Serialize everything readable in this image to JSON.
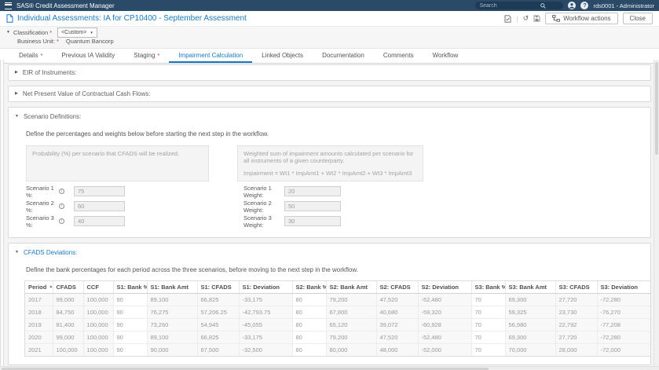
{
  "topbar": {
    "app_title": "SAS® Credit Assessment Manager",
    "search_placeholder": "Search",
    "username": "rds0001 - Administrator"
  },
  "titlebar": {
    "page_title": "Individual Assessments: IA for CP10400 - September Assessment",
    "workflow_actions_label": "Workflow actions",
    "close_label": "Close"
  },
  "meta": {
    "classification_label": "Classification",
    "classification_required": "*",
    "classification_value": "<Custom>",
    "business_unit_label": "Business Unit:",
    "business_unit_required": "*",
    "business_unit_value": "Quantum Bancorp"
  },
  "tabs": [
    {
      "label": "Details",
      "required_marker": "*"
    },
    {
      "label": "Previous IA Validity"
    },
    {
      "label": "Staging",
      "required_marker": "*"
    },
    {
      "label": "Impairment Calculation",
      "active": true
    },
    {
      "label": "Linked Objects"
    },
    {
      "label": "Documentation"
    },
    {
      "label": "Comments"
    },
    {
      "label": "Workflow"
    }
  ],
  "sections": {
    "eir": {
      "title": "EIR of Instruments:"
    },
    "npv": {
      "title": "Net Present Value of Contractual Cash Flows:"
    },
    "scenario": {
      "title": "Scenario Definitions:",
      "description": "Define the percentages and weights below before starting the next step in the workflow.",
      "probability_note": "Probability (%) per scenario that CFADS will be realized.",
      "weight_note": "Weighted sum of impairment amounts calculated per scenario for all instruments of a given counterparty.",
      "weight_formula": "Impairment = Wt1 * ImpAmt1 + Wt2 * ImpAmt2 + Wt3 * ImpAmt3",
      "rows": [
        {
          "pct_label": "Scenario 1 %:",
          "pct_value": "75",
          "weight_label": "Scenario 1 Weight:",
          "weight_value": "20"
        },
        {
          "pct_label": "Scenario 2 %:",
          "pct_value": "60",
          "weight_label": "Scenario 2 Weight:",
          "weight_value": "50"
        },
        {
          "pct_label": "Scenario 3 %:",
          "pct_value": "40",
          "weight_label": "Scenario 3 Weight:",
          "weight_value": "30"
        }
      ]
    },
    "cfads": {
      "title": "CFADS Deviations:",
      "description": "Define the bank percentages for each period across the three scenarios, before moving to the next step in the workflow.",
      "table": {
        "columns": [
          "Period",
          "CFADS",
          "CCF",
          "S1: Bank %",
          "S1: Bank Amt",
          "S1: CFADS",
          "S1: Deviation",
          "S2: Bank %",
          "S2: Bank Amt",
          "S2: CFADS",
          "S2: Deviation",
          "S3: Bank %",
          "S3: Bank Amt",
          "S3: CFADS",
          "S3: Deviation"
        ],
        "sorted_column_index": 0,
        "sort_glyph": "▲",
        "editable_column_indices": [
          3,
          7,
          11
        ],
        "rows": [
          [
            "2017",
            "99,000",
            "100,000",
            "90",
            "89,100",
            "66,825",
            "-33,175",
            "80",
            "79,200",
            "47,520",
            "-52,480",
            "70",
            "69,300",
            "27,720",
            "-72,280"
          ],
          [
            "2018",
            "84,750",
            "100,000",
            "90",
            "76,275",
            "57,206.25",
            "-42,793.75",
            "80",
            "67,800",
            "40,680",
            "-59,320",
            "70",
            "59,325",
            "23,730",
            "-76,270"
          ],
          [
            "2019",
            "81,400",
            "100,000",
            "90",
            "73,260",
            "54,945",
            "-45,055",
            "80",
            "65,120",
            "39,072",
            "-60,928",
            "70",
            "56,980",
            "22,792",
            "-77,208"
          ],
          [
            "2020",
            "99,000",
            "100,000",
            "90",
            "89,100",
            "66,825",
            "-33,175",
            "80",
            "79,200",
            "47,520",
            "-52,480",
            "70",
            "69,300",
            "27,720",
            "-72,280"
          ],
          [
            "2021",
            "100,000",
            "100,000",
            "90",
            "90,000",
            "67,500",
            "-32,500",
            "80",
            "80,000",
            "48,000",
            "-52,000",
            "70",
            "70,000",
            "28,000",
            "-72,000"
          ]
        ]
      }
    }
  },
  "icons": {
    "collapsed": "▶",
    "expanded": "▼",
    "dropdown_caret": "▼",
    "help": "?",
    "history": "↺",
    "classification_twisty": "▼"
  },
  "colors": {
    "topbar_bg": "#2a4a68",
    "accent_blue": "#1879c0",
    "required_red": "#c2362b",
    "content_bg": "#f4f4f4"
  }
}
